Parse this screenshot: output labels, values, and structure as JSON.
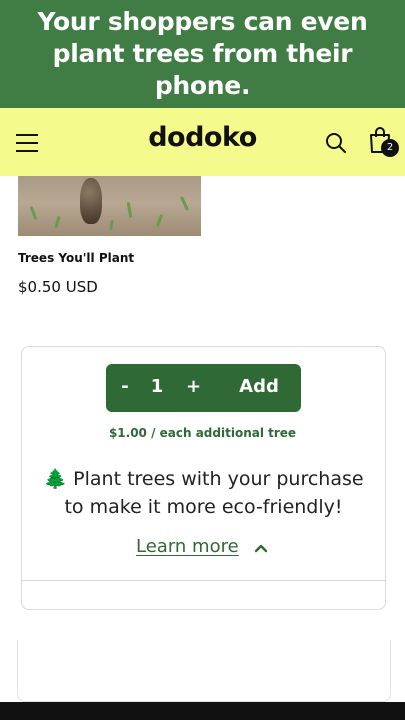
{
  "promo": {
    "line1": "Your shoppers can even",
    "line2": "plant trees from their phone."
  },
  "header": {
    "logo": "dodoko",
    "cart_count": "2",
    "icons": [
      "menu-icon",
      "search-icon",
      "shopping-bag-icon"
    ]
  },
  "product": {
    "title": "Trees You'll Plant",
    "price": "$0.50 USD"
  },
  "widget": {
    "minus_label": "-",
    "quantity": "1",
    "plus_label": "+",
    "add_label": "Add",
    "per_tree_text": "$1.00 / each additional tree",
    "tree_glyph": "🌲",
    "message": "Plant trees with your purchase to make it more eco-friendly!",
    "learn_more": "Learn more"
  },
  "colors": {
    "banner": "#3f7d45",
    "header": "#f5fa8c",
    "accent": "#2f6a36"
  }
}
